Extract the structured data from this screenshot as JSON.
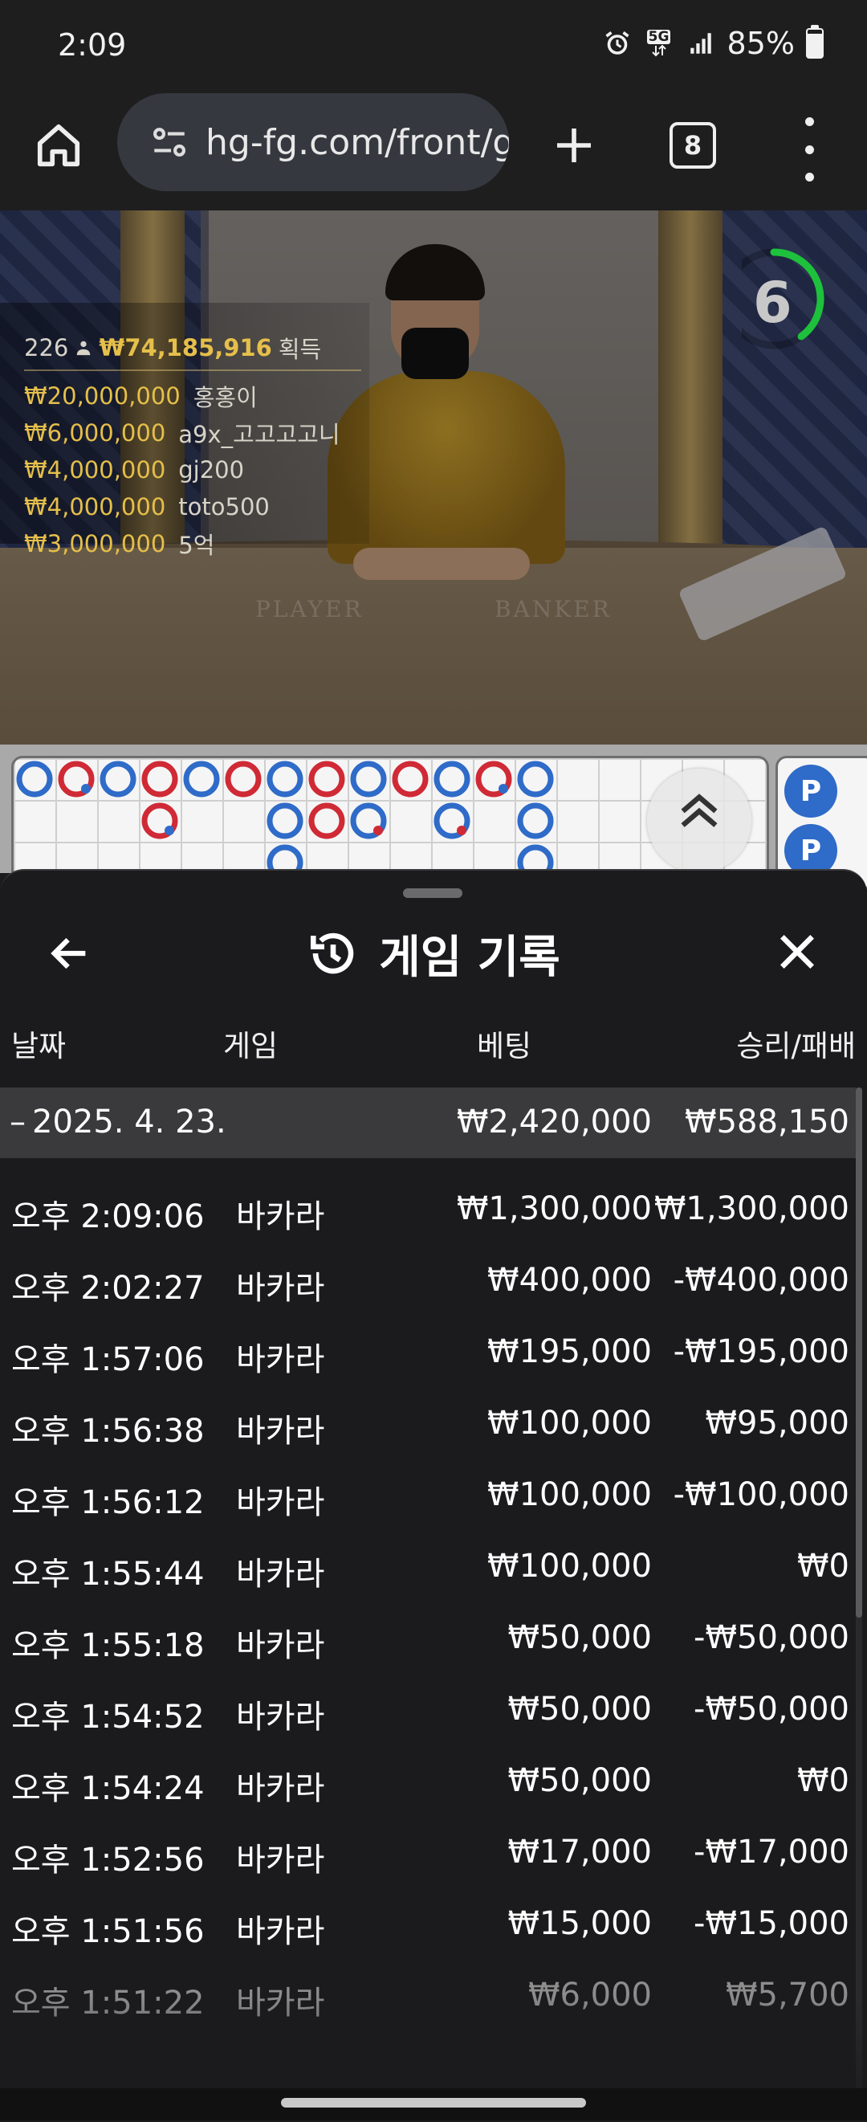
{
  "status_bar": {
    "time": "2:09",
    "network": "5G",
    "battery": "85%",
    "battery_level": 0.85
  },
  "browser": {
    "url": "hg-fg.com/front/g",
    "tab_count": "8",
    "icons": [
      "home-icon",
      "site-settings-icon",
      "plus-icon",
      "tabs-icon",
      "more-vert-icon"
    ]
  },
  "video": {
    "table_labels": [
      "PLAYER",
      "BANKER"
    ],
    "winners_count": "226",
    "winners_total": "₩74,185,916",
    "winners_suffix": "획득",
    "winners": [
      {
        "amount": "₩20,000,000",
        "name": "홍홍이"
      },
      {
        "amount": "₩6,000,000",
        "name": "a9x_고고고고니"
      },
      {
        "amount": "₩4,000,000",
        "name": "gj200"
      },
      {
        "amount": "₩4,000,000",
        "name": "toto500"
      },
      {
        "amount": "₩3,000,000",
        "name": "5억"
      }
    ],
    "countdown": "6",
    "countdown_fraction": 0.4,
    "countdown_color": "#1ec13c"
  },
  "road": {
    "banker_color": "#cf2a35",
    "player_color": "#2f6bc8",
    "bead_labels": [
      "P",
      "P"
    ]
  },
  "sheet": {
    "title": "게임 기록",
    "columns": {
      "date": "날짜",
      "game": "게임",
      "bet": "베팅",
      "win_loss": "승리/패배"
    },
    "group": {
      "toggle": "–",
      "date": "2025. 4. 23.",
      "bet": "₩2,420,000",
      "win_loss": "₩588,150"
    },
    "rows": [
      {
        "time": "오후 2:09:06",
        "game": "바카라",
        "bet": "₩1,300,000",
        "win_loss": "₩1,300,000"
      },
      {
        "time": "오후 2:02:27",
        "game": "바카라",
        "bet": "₩400,000",
        "win_loss": "-₩400,000"
      },
      {
        "time": "오후 1:57:06",
        "game": "바카라",
        "bet": "₩195,000",
        "win_loss": "-₩195,000"
      },
      {
        "time": "오후 1:56:38",
        "game": "바카라",
        "bet": "₩100,000",
        "win_loss": "₩95,000"
      },
      {
        "time": "오후 1:56:12",
        "game": "바카라",
        "bet": "₩100,000",
        "win_loss": "-₩100,000"
      },
      {
        "time": "오후 1:55:44",
        "game": "바카라",
        "bet": "₩100,000",
        "win_loss": "₩0"
      },
      {
        "time": "오후 1:55:18",
        "game": "바카라",
        "bet": "₩50,000",
        "win_loss": "-₩50,000"
      },
      {
        "time": "오후 1:54:52",
        "game": "바카라",
        "bet": "₩50,000",
        "win_loss": "-₩50,000"
      },
      {
        "time": "오후 1:54:24",
        "game": "바카라",
        "bet": "₩50,000",
        "win_loss": "₩0"
      },
      {
        "time": "오후 1:52:56",
        "game": "바카라",
        "bet": "₩17,000",
        "win_loss": "-₩17,000"
      },
      {
        "time": "오후 1:51:56",
        "game": "바카라",
        "bet": "₩15,000",
        "win_loss": "-₩15,000"
      },
      {
        "time": "오후 1:51:22",
        "game": "바카라",
        "bet": "₩6,000",
        "win_loss": "₩5,700"
      }
    ]
  }
}
